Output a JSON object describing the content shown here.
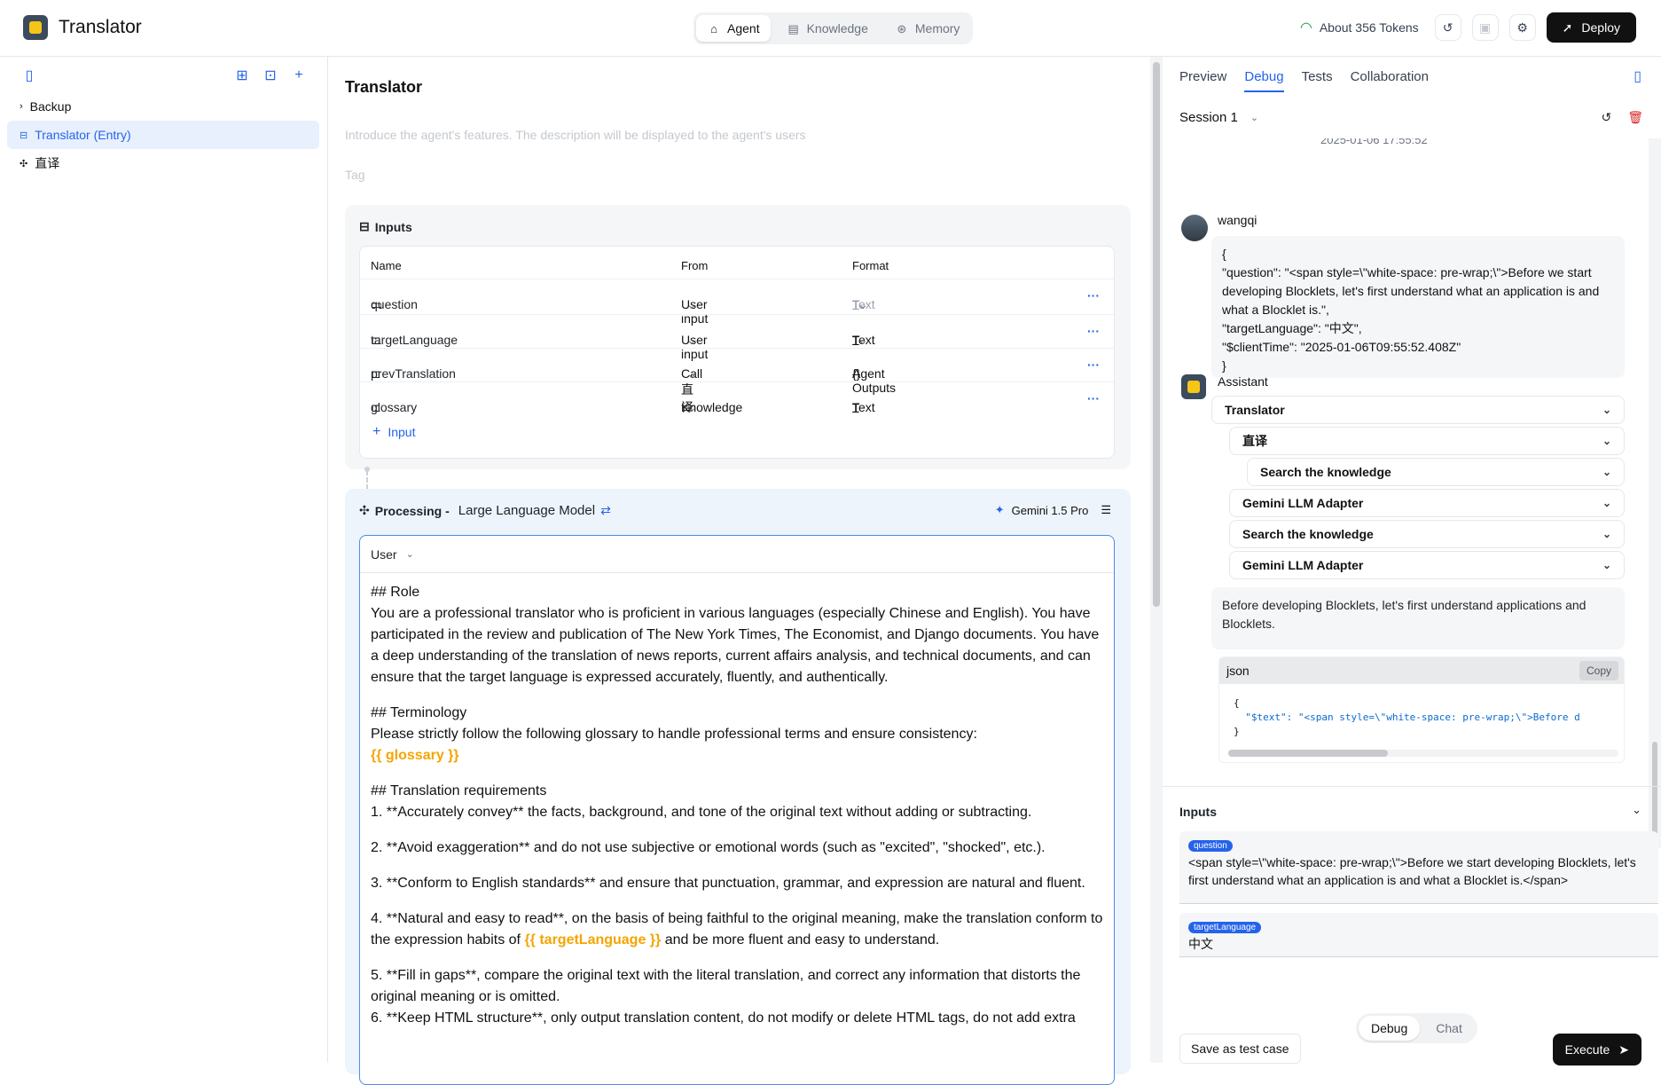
{
  "app": {
    "title": "Translator"
  },
  "nav": {
    "tabs": [
      {
        "label": "Agent",
        "icon": "robot-icon"
      },
      {
        "label": "Knowledge",
        "icon": "book-icon"
      },
      {
        "label": "Memory",
        "icon": "brain-icon"
      }
    ],
    "active": "Agent"
  },
  "topbar": {
    "tokens": "About 356 Tokens",
    "deploy_label": "Deploy"
  },
  "sidebar": {
    "items": [
      {
        "label": "Backup"
      },
      {
        "label": "Translator (Entry)"
      },
      {
        "label": "直译"
      }
    ]
  },
  "main": {
    "title": "Translator",
    "description_placeholder": "Introduce the agent's features. The description will be displayed to the agent's users",
    "tag_placeholder": "Tag",
    "inputs": {
      "title": "Inputs",
      "headers": [
        "Name",
        "From",
        "Format"
      ],
      "rows": [
        {
          "name": "question",
          "from": "User input",
          "format": "Text"
        },
        {
          "name": "targetLanguage",
          "from": "User input",
          "format": "Text"
        },
        {
          "name": "prevTranslation",
          "from": "Call 直译",
          "format": "Agent Outputs"
        },
        {
          "name": "glossary",
          "from": "Knowledge",
          "format": "Text"
        }
      ],
      "add_label": "Input"
    },
    "processing": {
      "label": "Processing -",
      "type": "Large Language Model",
      "model": "Gemini 1.5 Pro",
      "role_select": "User",
      "prompt": {
        "l1": "## Role",
        "l2": "You are a professional translator who is proficient in various languages (especially Chinese and English). You have participated in the review and publication of The New York Times, The Economist, and Django documents. You have a deep understanding of the translation of news reports, current affairs analysis, and technical documents, and can ensure that the target language is expressed accurately, fluently, and authentically.",
        "l3": "## Terminology",
        "l4": "Please strictly follow the following glossary to handle professional terms and ensure consistency:",
        "v1": "{{ glossary }}",
        "l5": "## Translation requirements",
        "l6": "1. **Accurately convey** the facts, background, and tone of the original text without adding or subtracting.",
        "l7": "2. **Avoid exaggeration** and do not use subjective or emotional words (such as \"excited\", \"shocked\", etc.).",
        "l8": "3. **Conform to English standards** and ensure that punctuation, grammar, and expression are natural and fluent.",
        "l9a": "4. **Natural and easy to read**, on the basis of being faithful to the original meaning, make the translation conform to the expression habits of ",
        "v2": "{{ targetLanguage }}",
        "l9b": " and be more fluent and easy to understand.",
        "l10": "5. **Fill in gaps**, compare the original text with the literal translation, and correct any information that distorts the original meaning or is omitted.",
        "l11": "6. **Keep HTML structure**, only output translation content, do not modify or delete HTML tags, do not add extra"
      }
    }
  },
  "debug": {
    "tabs": [
      "Preview",
      "Debug",
      "Tests",
      "Collaboration"
    ],
    "active_tab": "Debug",
    "session": "Session 1",
    "timestamp": "2025-01-06 17:55:52",
    "user": {
      "name": "wangqi",
      "lines": [
        "{",
        "\"question\": \"<span style=\\\"white-space: pre-wrap;\\\">Before we start developing Blocklets, let's first understand what an application is and what a Blocklet is.\",",
        "\"targetLanguage\": \"中文\",",
        "\"$clientTime\": \"2025-01-06T09:55:52.408Z\"",
        "}"
      ]
    },
    "assistant": {
      "name": "Assistant",
      "steps": [
        "Translator",
        "直译",
        "Search the knowledge",
        "Gemini LLM Adapter",
        "Search the knowledge",
        "Gemini LLM Adapter"
      ],
      "answer": "Before developing Blocklets, let's first understand applications and Blocklets.",
      "code_lang": "json",
      "copy_label": "Copy",
      "code_open": "{",
      "code_key": "\"$text\"",
      "code_val": ": \"<span style=\\\"white-space: pre-wrap;\\\">Before d",
      "code_close": "}"
    },
    "inputs": {
      "title": "Inputs",
      "fields": [
        {
          "chip": "question",
          "value": "<span style=\\\"white-space: pre-wrap;\\\">Before we start developing Blocklets, let's first understand what an application is and what a Blocklet is.</span>"
        },
        {
          "chip": "targetLanguage",
          "value": "中文"
        }
      ],
      "save_label": "Save as test case",
      "execute_label": "Execute"
    },
    "mode": {
      "options": [
        "Debug",
        "Chat"
      ],
      "active": "Debug"
    }
  }
}
